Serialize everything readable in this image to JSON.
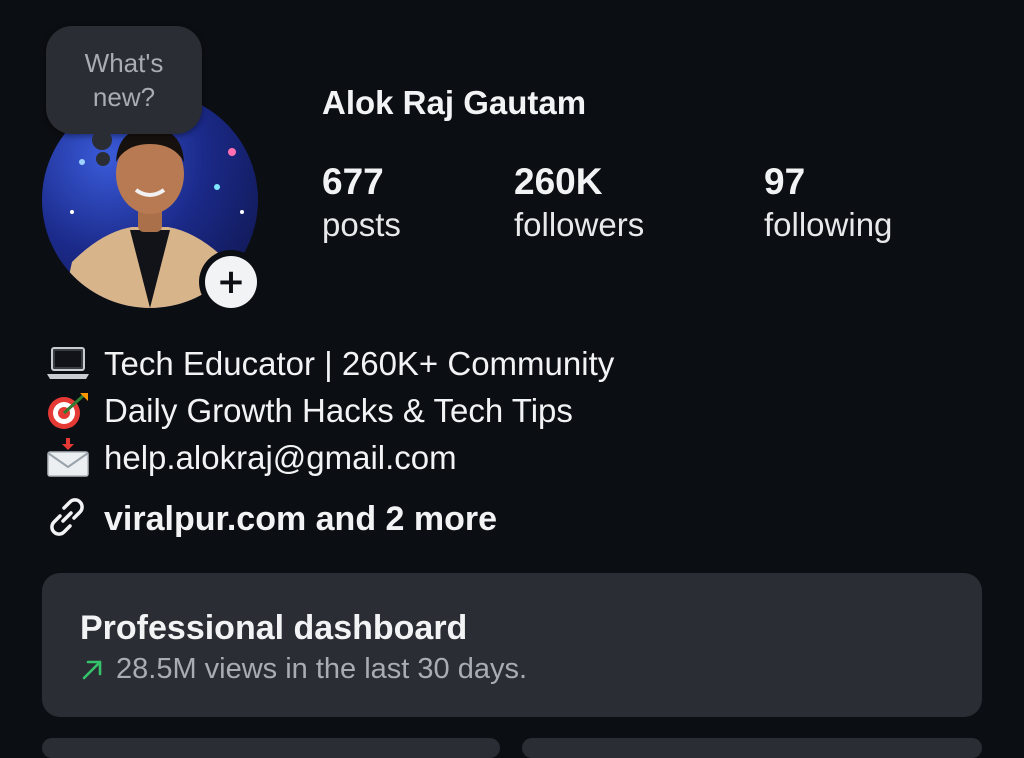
{
  "note": {
    "text_line1": "What's",
    "text_line2": "new?"
  },
  "profile": {
    "name": "Alok Raj Gautam",
    "stats": [
      {
        "value": "677",
        "label": "posts"
      },
      {
        "value": "260K",
        "label": "followers"
      },
      {
        "value": "97",
        "label": "following"
      }
    ],
    "add_story_icon": "plus-icon"
  },
  "bio": [
    {
      "icon": "laptop-emoji",
      "text": "Tech Educator | 260K+ Community"
    },
    {
      "icon": "direct-hit-emoji",
      "text": "Daily Growth Hacks & Tech Tips"
    },
    {
      "icon": "incoming-envelope-emoji",
      "text": "help.alokraj@gmail.com"
    }
  ],
  "link": {
    "icon": "link-icon",
    "label": "viralpur.com and 2 more"
  },
  "dashboard": {
    "title": "Professional dashboard",
    "subtitle": "28.5M views in the last 30 days.",
    "trend_icon": "trend-up-arrow-icon",
    "trend_color": "#35c46a"
  },
  "colors": {
    "background": "#0b0e12",
    "card": "#2a2d33",
    "text": "#f2f3f5",
    "muted": "#a8acb3"
  }
}
